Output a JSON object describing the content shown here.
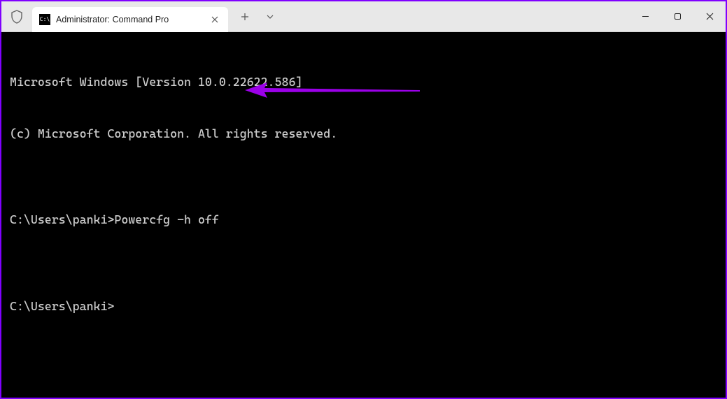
{
  "window": {
    "tab_title": "Administrator: Command Pro"
  },
  "terminal": {
    "line1": "Microsoft Windows [Version 10.0.22622.586]",
    "line2": "(c) Microsoft Corporation. All rights reserved.",
    "blank1": "",
    "prompt1_path": "C:\\Users\\panki>",
    "prompt1_cmd": "Powercfg -h off",
    "blank2": "",
    "prompt2_path": "C:\\Users\\panki>"
  }
}
